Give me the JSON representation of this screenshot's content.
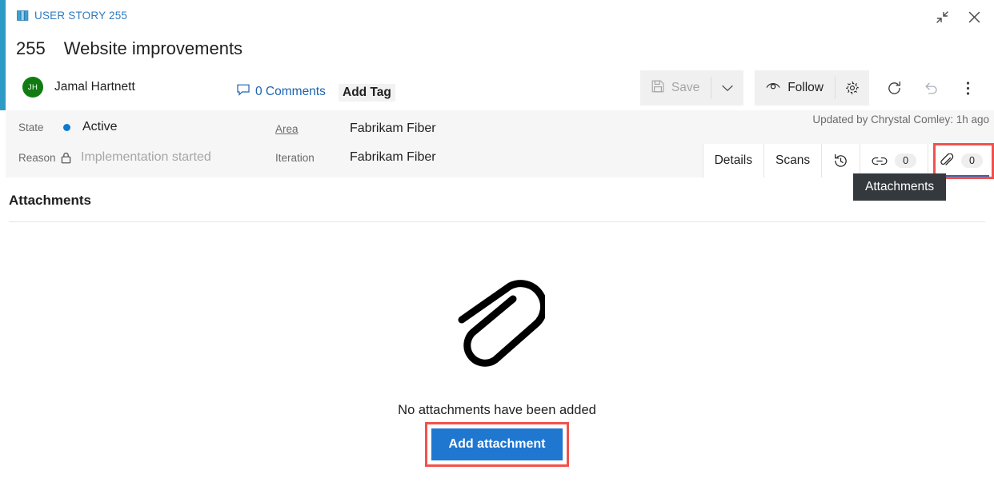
{
  "window": {
    "breadcrumb": "USER STORY 255",
    "breadcrumb_icon": "book-icon",
    "restore_icon": "restore-window-icon",
    "close_icon": "close-icon"
  },
  "work_item": {
    "id": "255",
    "title": "Website improvements",
    "assignee": "Jamal Hartnett",
    "assignee_initials": "JH",
    "avatar_color": "#107c10",
    "comments_label": "0 Comments",
    "comments_icon": "comment-bubble-icon",
    "add_tag_label": "Add Tag"
  },
  "toolbar": {
    "save_label": "Save",
    "save_icon": "save-disk-icon",
    "save_disabled": true,
    "save_dropdown_icon": "chevron-down-icon",
    "follow_label": "Follow",
    "follow_icon": "eye-icon",
    "settings_icon": "gear-icon",
    "refresh_icon": "refresh-icon",
    "undo_icon": "undo-icon",
    "more_icon": "more-vertical-icon"
  },
  "fields": {
    "state": {
      "label": "State",
      "value": "Active",
      "dot_color": "#0b7ad1"
    },
    "reason": {
      "label": "Reason",
      "value": "Implementation started",
      "icon": "lock-icon",
      "readonly": true
    },
    "area": {
      "label": "Area",
      "value": "Fabrikam Fiber"
    },
    "iteration": {
      "label": "Iteration",
      "value": "Fabrikam Fiber"
    }
  },
  "updated_text": "Updated by Chrystal Comley: 1h ago",
  "tabs": [
    {
      "label": "Details",
      "name": "tab-details"
    },
    {
      "label": "Scans",
      "name": "tab-scans"
    },
    {
      "label": "",
      "icon": "history-icon",
      "name": "tab-history"
    },
    {
      "label": "",
      "icon": "link-icon",
      "count": "0",
      "name": "tab-links"
    },
    {
      "label": "",
      "icon": "paperclip-icon",
      "count": "0",
      "name": "tab-attachments",
      "active": true
    }
  ],
  "tooltip": "Attachments",
  "section": {
    "title": "Attachments",
    "empty_text": "No attachments have been added",
    "empty_icon": "paperclip-large-icon",
    "add_button_label": "Add attachment"
  },
  "colors": {
    "accent_strip": "#2e9bc7",
    "link": "#1c63b0",
    "primary_button": "#1f77d0",
    "highlight_outline": "#f2524e",
    "tab_underline": "#1f6fc4"
  }
}
